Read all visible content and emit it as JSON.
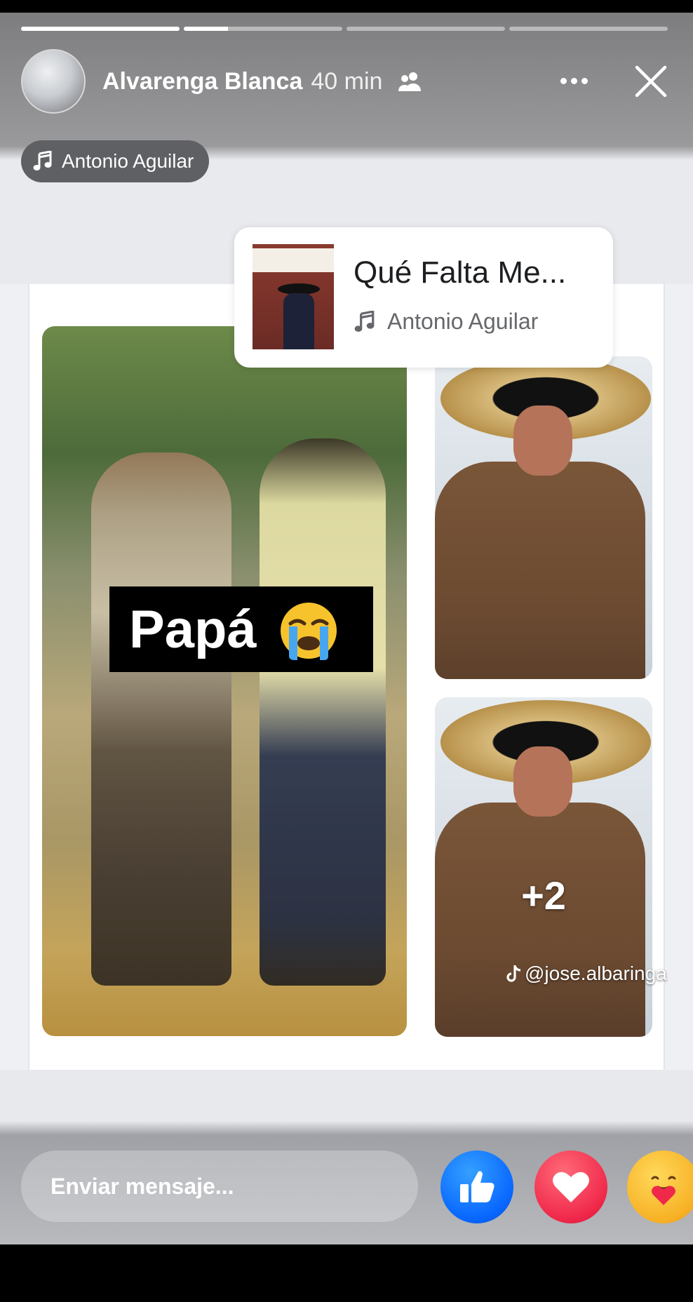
{
  "story": {
    "progress": [
      {
        "fraction": 1.0
      },
      {
        "fraction": 0.28
      },
      {
        "fraction": 0.0
      },
      {
        "fraction": 0.0
      }
    ],
    "header": {
      "username": "Alvarenga Blanca",
      "time_ago": "40 min",
      "audience_icon": "friends-icon",
      "more_icon": "more-dots-icon",
      "close_icon": "close-icon"
    },
    "music_chip": {
      "label": "Antonio Aguilar",
      "icon": "music-note-icon"
    },
    "song_sticker": {
      "title": "Qué Falta Me...",
      "artist": "Antonio Aguilar",
      "icon": "music-note-icon"
    },
    "post": {
      "caption": "Papá",
      "caption_emoji": "crying-face-icon",
      "more_photos": "+2",
      "watermark": "@jose.albaringa",
      "watermark_icon": "tiktok-icon"
    },
    "footer": {
      "message_placeholder": "Enviar mensaje...",
      "reactions": [
        "like-icon",
        "love-icon",
        "care-icon"
      ]
    }
  },
  "colors": {
    "like": "#0866ff",
    "love": "#f0284a",
    "care": "#f7b125"
  }
}
